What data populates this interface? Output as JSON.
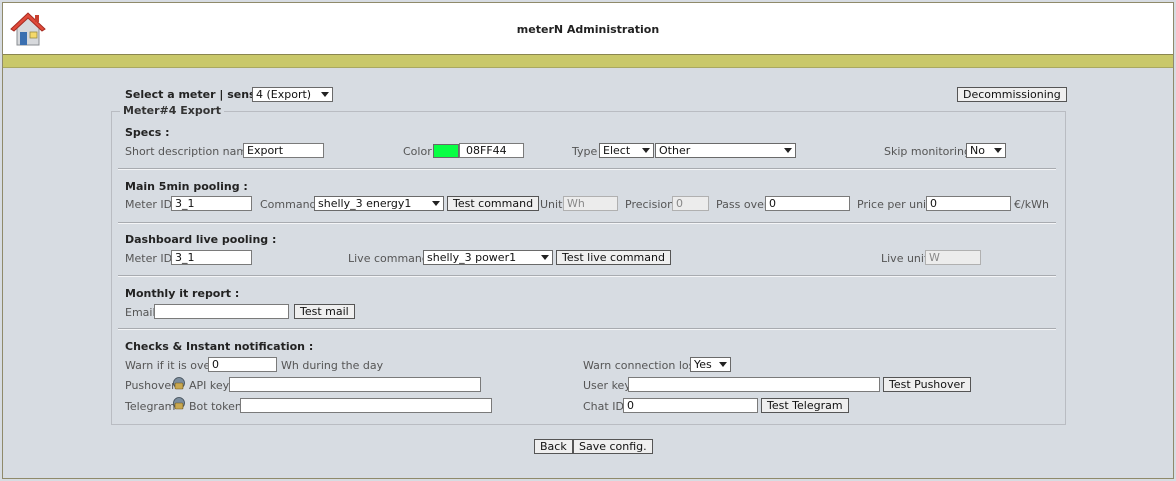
{
  "header": {
    "title": "meterN Administration",
    "home_icon": "home-icon"
  },
  "meter_select": {
    "label": "Select a meter | sensor :",
    "value": "4 (Export)"
  },
  "decommission_button": "Decommissioning",
  "fieldset_legend": "Meter#4 Export",
  "specs": {
    "heading": "Specs :",
    "short_desc_label": "Short description name",
    "short_desc_value": "Export",
    "color_label": "Color",
    "color_value": "08FF44",
    "color_hex": "#08ff44",
    "type_label": "Type",
    "type_value": "Elect",
    "type2_value": "Other",
    "skip_label": "Skip monitoring",
    "skip_value": "No"
  },
  "pooling": {
    "heading": "Main 5min pooling :",
    "meter_id_label": "Meter ID",
    "meter_id_value": "3_1",
    "command_label": "Command",
    "command_value": "shelly_3 energy1",
    "test_button": "Test command",
    "unit_label": "Unit",
    "unit_value": "Wh",
    "precision_label": "Precision",
    "precision_value": "0",
    "passover_label": "Pass over",
    "passover_value": "0",
    "price_label": "Price per unit",
    "price_value": "0",
    "price_unit": "€/kWh"
  },
  "live": {
    "heading": "Dashboard live pooling :",
    "meter_id_label": "Meter ID",
    "meter_id_value": "3_1",
    "command_label": "Live command",
    "command_value": "shelly_3 power1",
    "test_button": "Test live command",
    "unit_label": "Live unit",
    "unit_value": "W"
  },
  "report": {
    "heading": "Monthly it report :",
    "email_label": "Email",
    "email_value": "",
    "test_button": "Test mail"
  },
  "checks": {
    "heading": "Checks & Instant notification :",
    "warn_label": "Warn if it is over",
    "warn_value": "0",
    "warn_suffix": "Wh during the day",
    "conn_label": "Warn connection lost",
    "conn_value": "Yes",
    "pushover_label": "Pushover",
    "pushover_key_label": "API key",
    "pushover_key_value": "",
    "user_key_label": "User key",
    "user_key_value": "",
    "pushover_button": "Test Pushover",
    "telegram_label": "Telegram",
    "telegram_token_label": "Bot token",
    "telegram_token_value": "",
    "chat_id_label": "Chat ID",
    "chat_id_value": "0",
    "telegram_button": "Test Telegram"
  },
  "footer": {
    "back_button": "Back",
    "save_button": "Save config."
  }
}
